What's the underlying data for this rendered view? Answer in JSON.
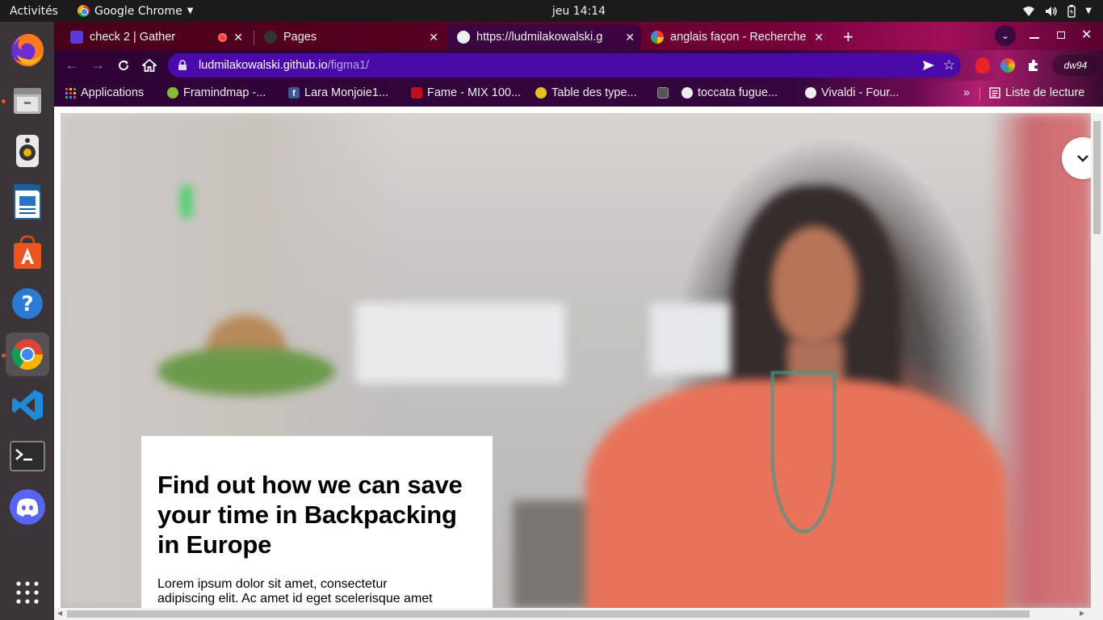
{
  "topbar": {
    "activities": "Activités",
    "app_name": "Google Chrome",
    "clock": "jeu 14:14"
  },
  "dock": {
    "apps": [
      "firefox",
      "files",
      "rhythmbox",
      "libreoffice-writer",
      "ubuntu-software",
      "help",
      "google-chrome",
      "vscode",
      "terminal",
      "discord",
      "show-applications"
    ]
  },
  "browser": {
    "tabs": [
      {
        "title": "check 2 | Gather",
        "active": false
      },
      {
        "title": "Pages",
        "active": false
      },
      {
        "title": "https://ludmilakowalski.g",
        "active": true
      },
      {
        "title": "anglais façon - Recherche",
        "active": false
      }
    ],
    "url_host": "ludmilakowalski.github.io",
    "url_path": "/figma1/",
    "bookmarks": [
      "Applications",
      "Framindmap -...",
      "Lara Monjoie1...",
      "Fame - MIX 100...",
      "Table des type...",
      "toccata fugue...",
      "Vivaldi - Four..."
    ],
    "reading_list": "Liste de lecture",
    "more": "»",
    "profile_text": "dw94"
  },
  "page": {
    "headline": "Find out how we can save your time in Backpacking in Europe",
    "body": "Lorem ipsum dolor sit amet, consectetur adipiscing elit. Ac amet id eget scelerisque amet"
  },
  "colors": {
    "ubuntu_orange": "#e95420",
    "tab_accent": "#4a0aa8",
    "shirt_coral": "#e8735a"
  }
}
